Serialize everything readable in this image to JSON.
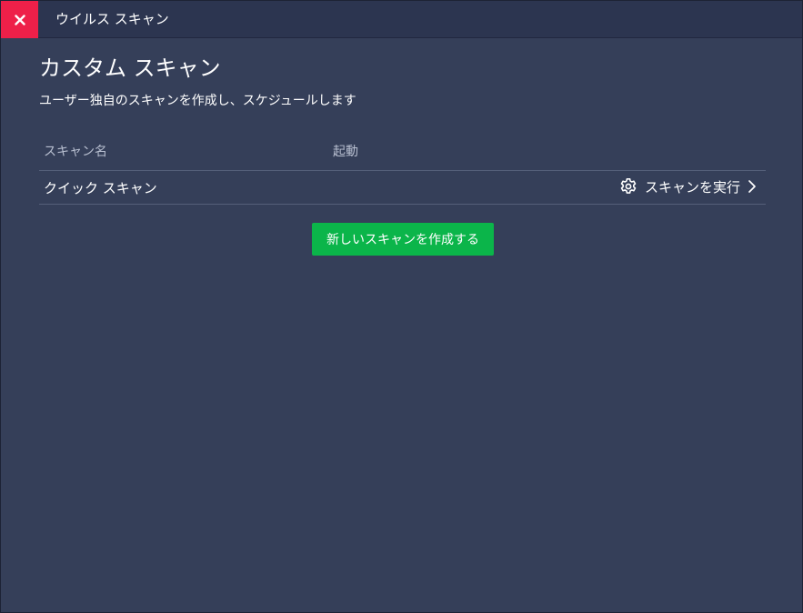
{
  "window": {
    "title": "ウイルス スキャン"
  },
  "page": {
    "title": "カスタム スキャン",
    "subtitle": "ユーザー独自のスキャンを作成し、スケジュールします"
  },
  "table": {
    "columns": [
      "スキャン名",
      "起動"
    ],
    "rows": [
      {
        "name": "クイック スキャン",
        "action_label": "スキャンを実行"
      }
    ]
  },
  "actions": {
    "create_label": "新しいスキャンを作成する"
  },
  "colors": {
    "background": "#353f59",
    "titlebar": "#2c3550",
    "close": "#ee2049",
    "primary": "#0bb54a",
    "divider": "#55607a"
  },
  "icons": {
    "close": "close-icon",
    "settings": "gear-icon",
    "chevron": "chevron-right-icon"
  }
}
